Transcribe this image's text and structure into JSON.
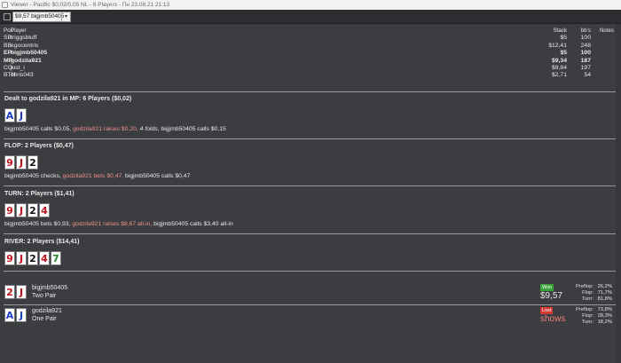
{
  "window": {
    "title": "Viewer - Pacific $0,02/0,05 NL - 6 Players - Пн 23.08.21 21:13"
  },
  "toolbar": {
    "selected_hand": "$9,57 bigjmb50405",
    "dropdown_icon": "chevron-down-icon"
  },
  "players_table": {
    "headers": {
      "pos": "Pos",
      "player": "Player",
      "stack": "Stack",
      "bbs": "bb's",
      "notes": "Notes"
    },
    "rows": [
      {
        "pos": "SB",
        "player": "triggsbluff",
        "stack": "$5",
        "bbs": "100",
        "bold": false
      },
      {
        "pos": "BB",
        "player": "egocentris",
        "stack": "$12,41",
        "bbs": "248",
        "bold": false
      },
      {
        "pos": "EP",
        "player": "bigjmb50405",
        "stack": "$5",
        "bbs": "100",
        "bold": true
      },
      {
        "pos": "MP",
        "player": "godzila921",
        "stack": "$9,34",
        "bbs": "187",
        "bold": true
      },
      {
        "pos": "CO",
        "player": "just_i",
        "stack": "$9,84",
        "bbs": "197",
        "bold": false
      },
      {
        "pos": "BTN",
        "player": "chris043",
        "stack": "$2,71",
        "bbs": "54",
        "bold": false
      }
    ]
  },
  "preflop": {
    "title": "Dealt to godzila921 in MP: 6 Players ($0,02)",
    "cards": [
      {
        "rank": "A",
        "color": "blue"
      },
      {
        "rank": "J",
        "color": "blue"
      }
    ],
    "actions": {
      "a1": "bigjmb50405 calls $0,05, ",
      "a2": "godzila921 raises $0,20, ",
      "a3": "4 folds, ",
      "a4": "bigjmb50405 calls $0,15"
    }
  },
  "flop": {
    "title": "FLOP: 2 Players ($0,47)",
    "cards": [
      {
        "rank": "9",
        "color": "red"
      },
      {
        "rank": "J",
        "color": "red"
      },
      {
        "rank": "2",
        "color": "black"
      }
    ],
    "actions": {
      "a1": "bigjmb50405 checks, ",
      "a2": "godzila921 bets $0,47, ",
      "a3": "bigjmb50405 calls $0,47"
    }
  },
  "turn": {
    "title": "TURN: 2 Players ($1,41)",
    "cards": [
      {
        "rank": "9",
        "color": "red"
      },
      {
        "rank": "J",
        "color": "red"
      },
      {
        "rank": "2",
        "color": "black"
      },
      {
        "rank": "4",
        "color": "red"
      }
    ],
    "actions": {
      "a1": "bigjmb50405 bets $0,93, ",
      "a2": "godzila921 raises $8,67 all-in, ",
      "a3": "bigjmb50405 calls $3,40 all-in"
    }
  },
  "river": {
    "title": "RIVER: 2 Players ($14,41)",
    "cards": [
      {
        "rank": "9",
        "color": "red"
      },
      {
        "rank": "J",
        "color": "red"
      },
      {
        "rank": "2",
        "color": "black"
      },
      {
        "rank": "4",
        "color": "red"
      },
      {
        "rank": "7",
        "color": "green"
      }
    ]
  },
  "results": [
    {
      "player": "bigjmb50405",
      "hand": "Two Pair",
      "cards": [
        {
          "rank": "2",
          "color": "red"
        },
        {
          "rank": "J",
          "color": "red"
        }
      ],
      "badge": "Won",
      "amount": "$9,57",
      "stats": [
        {
          "label": "Preflop:",
          "value": "26,2%"
        },
        {
          "label": "Flop:",
          "value": "71,7%"
        },
        {
          "label": "Turn:",
          "value": "81,8%"
        }
      ]
    },
    {
      "player": "godzila921",
      "hand": "One Pair",
      "cards": [
        {
          "rank": "A",
          "color": "blue"
        },
        {
          "rank": "J",
          "color": "blue"
        }
      ],
      "badge": "Lost",
      "amount": "shows",
      "stats": [
        {
          "label": "Preflop:",
          "value": "73,8%"
        },
        {
          "label": "Flop:",
          "value": "28,3%"
        },
        {
          "label": "Turn:",
          "value": "18,2%"
        }
      ]
    }
  ]
}
